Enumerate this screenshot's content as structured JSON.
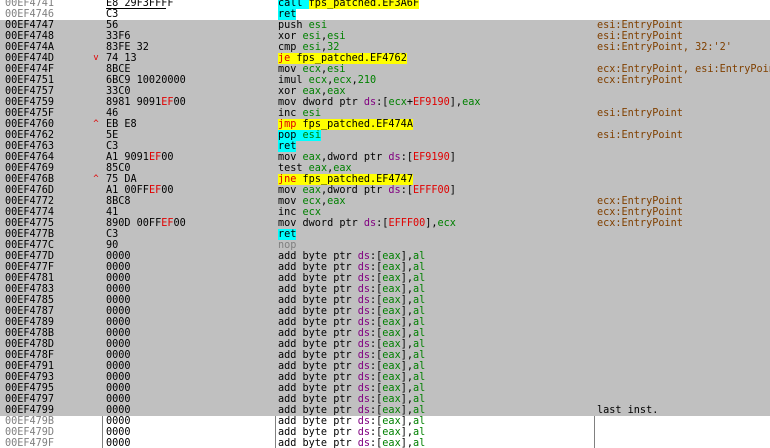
{
  "rows": [
    {
      "addr": "00EF4741",
      "arrow": "",
      "bytes": "E8 29F3FFFF",
      "kind": "call",
      "m": "call",
      "target": "fps_patched.EF3A6F",
      "cmt": "",
      "first": true
    },
    {
      "addr": "00EF4746",
      "arrow": "",
      "bytes": "C3",
      "kind": "ret",
      "m": "ret",
      "cmt": "",
      "first": true
    },
    {
      "addr": "00EF4747",
      "arrow": "",
      "bytes": "56",
      "kind": "text",
      "parts": [
        [
          "m",
          "push "
        ],
        [
          "r",
          "esi"
        ]
      ],
      "cmt": "esi:EntryPoint"
    },
    {
      "addr": "00EF4748",
      "arrow": "",
      "bytes": "33F6",
      "kind": "text",
      "parts": [
        [
          "m",
          "xor "
        ],
        [
          "r",
          "esi"
        ],
        [
          "m",
          ","
        ],
        [
          "r",
          "esi"
        ]
      ],
      "cmt": "esi:EntryPoint"
    },
    {
      "addr": "00EF474A",
      "arrow": "",
      "bytes": "83FE 32",
      "kind": "text",
      "parts": [
        [
          "m",
          "cmp "
        ],
        [
          "r",
          "esi"
        ],
        [
          "m",
          ","
        ],
        [
          "n",
          "32"
        ]
      ],
      "cmt": "esi:EntryPoint, 32:'2'"
    },
    {
      "addr": "00EF474D",
      "arrow": "v",
      "bytes": "74 13",
      "kind": "jump",
      "m": "je",
      "target": "fps_patched.EF4762",
      "cmt": ""
    },
    {
      "addr": "00EF474F",
      "arrow": "",
      "bytes": "8BCE",
      "kind": "text",
      "parts": [
        [
          "m",
          "mov "
        ],
        [
          "r",
          "ecx"
        ],
        [
          "m",
          ","
        ],
        [
          "r",
          "esi"
        ]
      ],
      "cmt": "ecx:EntryPoint, esi:EntryPoint"
    },
    {
      "addr": "00EF4751",
      "arrow": "",
      "bytes": "6BC9 10020000",
      "kind": "text",
      "parts": [
        [
          "m",
          "imul "
        ],
        [
          "r",
          "ecx"
        ],
        [
          "m",
          ","
        ],
        [
          "r",
          "ecx"
        ],
        [
          "m",
          ","
        ],
        [
          "n",
          "210"
        ]
      ],
      "cmt": "ecx:EntryPoint"
    },
    {
      "addr": "00EF4757",
      "arrow": "",
      "bytes": "33C0",
      "kind": "text",
      "parts": [
        [
          "m",
          "xor "
        ],
        [
          "r",
          "eax"
        ],
        [
          "m",
          ","
        ],
        [
          "r",
          "eax"
        ]
      ],
      "cmt": ""
    },
    {
      "addr": "00EF4759",
      "arrow": "",
      "bytes": "8981 9091EF00",
      "kind": "text",
      "bred": "EF",
      "parts": [
        [
          "m",
          "mov dword ptr "
        ],
        [
          "s",
          "ds"
        ],
        [
          "m",
          ":["
        ],
        [
          "r",
          "ecx"
        ],
        [
          "m",
          "+"
        ],
        [
          "x",
          "EF9190"
        ],
        [
          "m",
          "],"
        ],
        [
          "r",
          "eax"
        ]
      ],
      "cmt": ""
    },
    {
      "addr": "00EF475F",
      "arrow": "",
      "bytes": "46",
      "kind": "text",
      "parts": [
        [
          "m",
          "inc "
        ],
        [
          "r",
          "esi"
        ]
      ],
      "cmt": "esi:EntryPoint"
    },
    {
      "addr": "00EF4760",
      "arrow": "^",
      "bytes": "EB E8",
      "kind": "jump",
      "m": "jmp",
      "target": "fps_patched.EF474A",
      "cmt": ""
    },
    {
      "addr": "00EF4762",
      "arrow": "",
      "bytes": "5E",
      "kind": "pop",
      "cmt": "esi:EntryPoint"
    },
    {
      "addr": "00EF4763",
      "arrow": "",
      "bytes": "C3",
      "kind": "ret",
      "m": "ret",
      "cmt": ""
    },
    {
      "addr": "00EF4764",
      "arrow": "",
      "bytes": "A1 9091EF00",
      "kind": "text",
      "bred": "EF",
      "parts": [
        [
          "m",
          "mov "
        ],
        [
          "r",
          "eax"
        ],
        [
          "m",
          ",dword ptr "
        ],
        [
          "s",
          "ds"
        ],
        [
          "m",
          ":["
        ],
        [
          "x",
          "EF9190"
        ],
        [
          "m",
          "]"
        ]
      ],
      "cmt": ""
    },
    {
      "addr": "00EF4769",
      "arrow": "",
      "bytes": "85C0",
      "kind": "text",
      "parts": [
        [
          "m",
          "test "
        ],
        [
          "r",
          "eax"
        ],
        [
          "m",
          ","
        ],
        [
          "r",
          "eax"
        ]
      ],
      "cmt": ""
    },
    {
      "addr": "00EF476B",
      "arrow": "^",
      "bytes": "75 DA",
      "kind": "jump",
      "m": "jne",
      "target": "fps_patched.EF4747",
      "cmt": ""
    },
    {
      "addr": "00EF476D",
      "arrow": "",
      "bytes": "A1 00FFEF00",
      "kind": "text",
      "bred": "EF",
      "parts": [
        [
          "m",
          "mov "
        ],
        [
          "r",
          "eax"
        ],
        [
          "m",
          ",dword ptr "
        ],
        [
          "s",
          "ds"
        ],
        [
          "m",
          ":["
        ],
        [
          "x",
          "EFFF00"
        ],
        [
          "m",
          "]"
        ]
      ],
      "cmt": ""
    },
    {
      "addr": "00EF4772",
      "arrow": "",
      "bytes": "8BC8",
      "kind": "text",
      "parts": [
        [
          "m",
          "mov "
        ],
        [
          "r",
          "ecx"
        ],
        [
          "m",
          ","
        ],
        [
          "r",
          "eax"
        ]
      ],
      "cmt": "ecx:EntryPoint"
    },
    {
      "addr": "00EF4774",
      "arrow": "",
      "bytes": "41",
      "kind": "text",
      "parts": [
        [
          "m",
          "inc "
        ],
        [
          "r",
          "ecx"
        ]
      ],
      "cmt": "ecx:EntryPoint"
    },
    {
      "addr": "00EF4775",
      "arrow": "",
      "bytes": "890D 00FFEF00",
      "kind": "text",
      "bred": "EF",
      "parts": [
        [
          "m",
          "mov dword ptr "
        ],
        [
          "s",
          "ds"
        ],
        [
          "m",
          ":["
        ],
        [
          "x",
          "EFFF00"
        ],
        [
          "m",
          "],"
        ],
        [
          "r",
          "ecx"
        ]
      ],
      "cmt": "ecx:EntryPoint"
    },
    {
      "addr": "00EF477B",
      "arrow": "",
      "bytes": "C3",
      "kind": "ret",
      "m": "ret",
      "cmt": ""
    },
    {
      "addr": "00EF477C",
      "arrow": "",
      "bytes": "90",
      "kind": "nop",
      "m": "nop",
      "cmt": ""
    },
    {
      "addr": "00EF477D",
      "arrow": "",
      "bytes": "0000",
      "kind": "add",
      "cmt": ""
    },
    {
      "addr": "00EF477F",
      "arrow": "",
      "bytes": "0000",
      "kind": "add",
      "cmt": ""
    },
    {
      "addr": "00EF4781",
      "arrow": "",
      "bytes": "0000",
      "kind": "add",
      "cmt": ""
    },
    {
      "addr": "00EF4783",
      "arrow": "",
      "bytes": "0000",
      "kind": "add",
      "cmt": ""
    },
    {
      "addr": "00EF4785",
      "arrow": "",
      "bytes": "0000",
      "kind": "add",
      "cmt": ""
    },
    {
      "addr": "00EF4787",
      "arrow": "",
      "bytes": "0000",
      "kind": "add",
      "cmt": ""
    },
    {
      "addr": "00EF4789",
      "arrow": "",
      "bytes": "0000",
      "kind": "add",
      "cmt": ""
    },
    {
      "addr": "00EF478B",
      "arrow": "",
      "bytes": "0000",
      "kind": "add",
      "cmt": ""
    },
    {
      "addr": "00EF478D",
      "arrow": "",
      "bytes": "0000",
      "kind": "add",
      "cmt": ""
    },
    {
      "addr": "00EF478F",
      "arrow": "",
      "bytes": "0000",
      "kind": "add",
      "cmt": ""
    },
    {
      "addr": "00EF4791",
      "arrow": "",
      "bytes": "0000",
      "kind": "add",
      "cmt": ""
    },
    {
      "addr": "00EF4793",
      "arrow": "",
      "bytes": "0000",
      "kind": "add",
      "cmt": ""
    },
    {
      "addr": "00EF4795",
      "arrow": "",
      "bytes": "0000",
      "kind": "add",
      "cmt": ""
    },
    {
      "addr": "00EF4797",
      "arrow": "",
      "bytes": "0000",
      "kind": "add",
      "cmt": ""
    },
    {
      "addr": "00EF4799",
      "arrow": "",
      "bytes": "0000",
      "kind": "add",
      "cmt": "last inst.",
      "cmtPlain": true,
      "last": true
    },
    {
      "addr": "00EF479B",
      "arrow": "",
      "bytes": "0000",
      "kind": "add",
      "cmt": "",
      "tail": true
    },
    {
      "addr": "00EF479D",
      "arrow": "",
      "bytes": "0000",
      "kind": "add",
      "cmt": "",
      "tail": true
    },
    {
      "addr": "00EF479F",
      "arrow": "",
      "bytes": "0000",
      "kind": "add",
      "cmt": "",
      "tail": true
    }
  ],
  "add_parts": [
    [
      "m",
      "add byte ptr "
    ],
    [
      "s",
      "ds"
    ],
    [
      "m",
      ":["
    ],
    [
      "r",
      "eax"
    ],
    [
      "m",
      "],"
    ],
    [
      "r",
      "al"
    ]
  ],
  "pop_parts": [
    [
      "m",
      "pop "
    ],
    [
      "r",
      "esi"
    ]
  ],
  "colors": {
    "selection": "#c0c0c0",
    "call_highlight": "#00ffff",
    "jump_highlight": "#ffff00",
    "register": "#008000",
    "segment": "#800080",
    "comment": "#804000"
  }
}
